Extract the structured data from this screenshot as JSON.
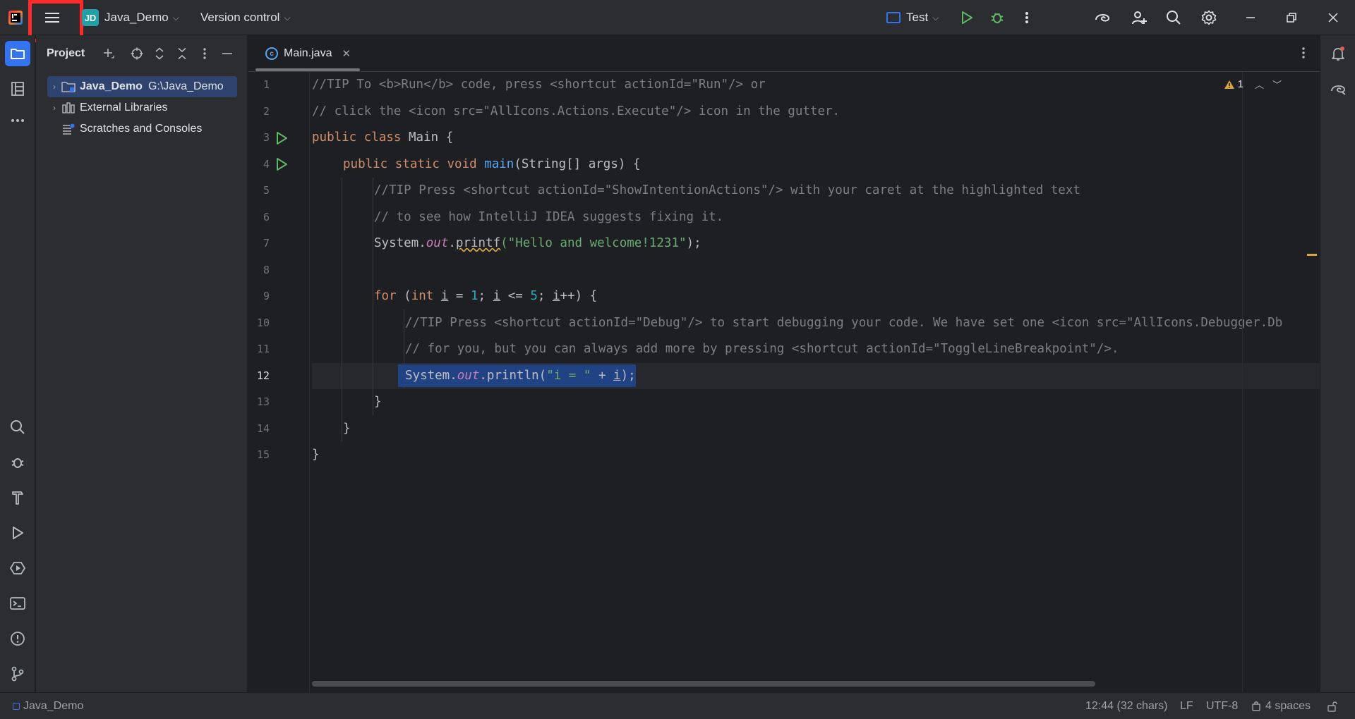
{
  "titlebar": {
    "project_badge": "JD",
    "project_name": "Java_Demo",
    "vcs_label": "Version control",
    "run_config": "Test"
  },
  "project_panel": {
    "title": "Project",
    "tree": [
      {
        "label": "Java_Demo",
        "path": "G:\\Java_Demo"
      },
      {
        "label": "External Libraries"
      },
      {
        "label": "Scratches and Consoles"
      }
    ]
  },
  "editor": {
    "tab_label": "Main.java",
    "inspection_count": "1",
    "current_line": 12,
    "line_numbers": [
      "1",
      "2",
      "3",
      "4",
      "5",
      "6",
      "7",
      "8",
      "9",
      "10",
      "11",
      "12",
      "13",
      "14",
      "15"
    ],
    "lines": {
      "l1": "//TIP To <b>Run</b> code, press <shortcut actionId=\"Run\"/> or",
      "l2": "// click the <icon src=\"AllIcons.Actions.Execute\"/> icon in the gutter.",
      "l3_kw": "public class",
      "l3_rest": " Main {",
      "l4_kw": "public static void",
      "l4_fn": "main",
      "l4_rest": "(String[] args) {",
      "l5": "//TIP Press <shortcut actionId=\"ShowIntentionActions\"/> with your caret at the highlighted text",
      "l6": "// to see how IntelliJ IDEA suggests fixing it.",
      "l7_a": "System.",
      "l7_out": "out",
      "l7_dot": ".",
      "l7_fn": "printf",
      "l7_str": "(\"Hello and welcome!1231\"",
      "l7_end": ");",
      "l9_for": "for",
      "l9_a": " (",
      "l9_int": "int",
      "l9_i1": "i",
      "l9_eq": " = ",
      "l9_n1": "1",
      "l9_semi1": "; ",
      "l9_i2": "i",
      "l9_le": " <= ",
      "l9_n5": "5",
      "l9_semi2": "; ",
      "l9_i3": "i",
      "l9_end": "++) {",
      "l10": "//TIP Press <shortcut actionId=\"Debug\"/> to start debugging your code. We have set one <icon src=\"AllIcons.Debugger.Db",
      "l11": "// for you, but you can always add more by pressing <shortcut actionId=\"ToggleLineBreakpoint\"/>.",
      "l12_a": "System.",
      "l12_out": "out",
      "l12_b": ".println(",
      "l12_str": "\"i = \"",
      "l12_plus": " + ",
      "l12_i": "i",
      "l12_end": ");",
      "l13": "}",
      "l14": "}",
      "l15": "}"
    }
  },
  "statusbar": {
    "project": "Java_Demo",
    "position": "12:44 (32 chars)",
    "line_ending": "LF",
    "encoding": "UTF-8",
    "indent": "4 spaces"
  },
  "colors": {
    "accent": "#3574f0",
    "highlight_box": "#ff2a2a",
    "run_green": "#5fb865",
    "selection": "#214283"
  }
}
